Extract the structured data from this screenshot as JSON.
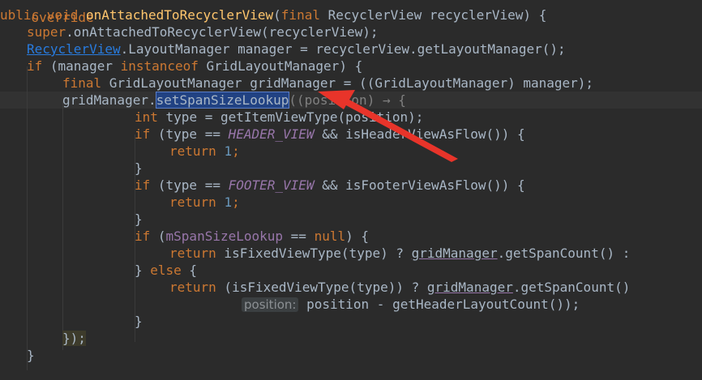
{
  "editor": {
    "lines": {
      "l0_text": "override",
      "l1_kw": "ublic void",
      "l1_fn": "onAttachedToRecyclerView",
      "l1_rest": "(",
      "l1_kw2": "final",
      "l1_rest2": " RecyclerView recyclerView) {",
      "l2_kw": "super",
      "l2_rest": ".onAttachedToRecyclerView(recyclerView);",
      "l3_link": "RecyclerView",
      "l3_rest": ".LayoutManager manager = recyclerView.getLayoutManager();",
      "l4_kw": "if",
      "l4_mid": " (manager ",
      "l4_kw2": "instanceof",
      "l4_rest": " GridLayoutManager) {",
      "l5_kw": "final",
      "l5_rest": " GridLayoutManager gridManager = ((GridLayoutManager) manager);",
      "l6_pre": "gridManager.",
      "l6_sel": "setSpanSizeLookup",
      "l6_rest": "((position) → {",
      "l7_kw": "int",
      "l7_rest": " type = getItemViewType(position);",
      "l8_kw": "if",
      "l8_mid": " (type == ",
      "l8_const": "HEADER_VIEW",
      "l8_rest": " && isHeaderViewAsFlow()) {",
      "l9_kw": "return",
      "l9_num": "1",
      "l9_end": ";",
      "l10": "}",
      "l11_kw": "if",
      "l11_mid": " (type == ",
      "l11_const": "FOOTER_VIEW",
      "l11_rest": " && isFooterViewAsFlow()) {",
      "l12_kw": "return",
      "l12_num": "1",
      "l12_end": ";",
      "l13": "}",
      "l14_kw": "if",
      "l14_mid": " (",
      "l14_field": "mSpanSizeLookup",
      "l14_mid2": " == ",
      "l14_kw2": "null",
      "l14_rest": ") {",
      "l15_kw": "return",
      "l15_mid": " isFixedViewType(type) ? ",
      "l15_var": "gridManager",
      "l15_rest": ".getSpanCount() :",
      "l16_pre": "} ",
      "l16_kw": "else",
      "l16_rest": " {",
      "l17_kw": "return",
      "l17_mid": " (isFixedViewType(type)) ? ",
      "l17_var": "gridManager",
      "l17_rest": ".getSpanCount()",
      "l18_hint": "position:",
      "l18_rest": " position - getHeaderLayoutCount());",
      "l19": "}",
      "l20": "});",
      "l21": "}"
    }
  },
  "colors": {
    "background": "#2b2b2b",
    "keyword": "#cc7832",
    "method": "#ffc66d",
    "number": "#6897bb",
    "constant": "#9876aa",
    "arrow": "#e8342a"
  },
  "annotation": {
    "icon": "red-arrow-icon",
    "points_to": "setSpanSizeLookup"
  }
}
